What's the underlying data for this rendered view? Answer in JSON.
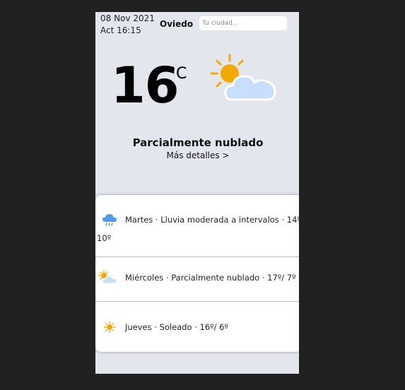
{
  "header": {
    "date": "08 Nov 2021",
    "updated": "Act 16:15",
    "city": "Oviedo",
    "search_placeholder": "Tu ciudad..."
  },
  "current": {
    "temperature": "16",
    "unit": "°C",
    "condition": "Parcialmente nublado",
    "icon": "sun-behind-cloud-icon",
    "details_link": "Más detalles >"
  },
  "forecast": [
    {
      "icon": "rain-cloud-icon",
      "text": "Martes · Lluvia moderada a intervalos · 14º/",
      "text_wrap": "10º"
    },
    {
      "icon": "sun-behind-cloud-icon",
      "text": "Miércoles · Parcialmente nublado · 17º/ 7º"
    },
    {
      "icon": "sun-icon",
      "text": "Jueves · Soleado · 16º/ 6º"
    }
  ],
  "colors": {
    "page_background": "#212121",
    "app_background": "#e4e6ee",
    "sun": "#f5a800",
    "cloud": "#c9defa"
  }
}
